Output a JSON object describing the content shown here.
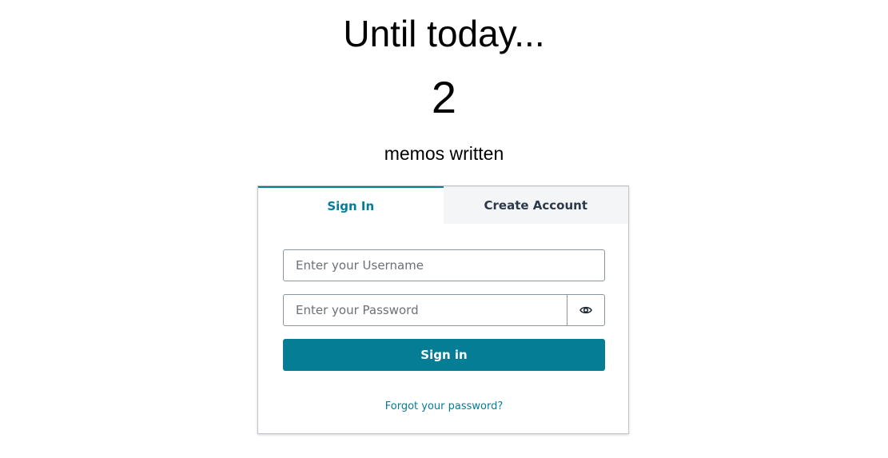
{
  "hero": {
    "title": "Until today...",
    "count": "2",
    "subtitle": "memos written"
  },
  "auth": {
    "tabs": [
      {
        "label": "Sign In",
        "active": true
      },
      {
        "label": "Create Account",
        "active": false
      }
    ],
    "username_placeholder": "Enter your Username",
    "username_value": "",
    "password_placeholder": "Enter your Password",
    "password_value": "",
    "show_password_icon": "eye-icon",
    "submit_label": "Sign in",
    "forgot_link": "Forgot your password?"
  },
  "colors": {
    "accent": "#047d95",
    "inactive_tab_bg": "#f4f5f6",
    "border": "#8c959f"
  }
}
